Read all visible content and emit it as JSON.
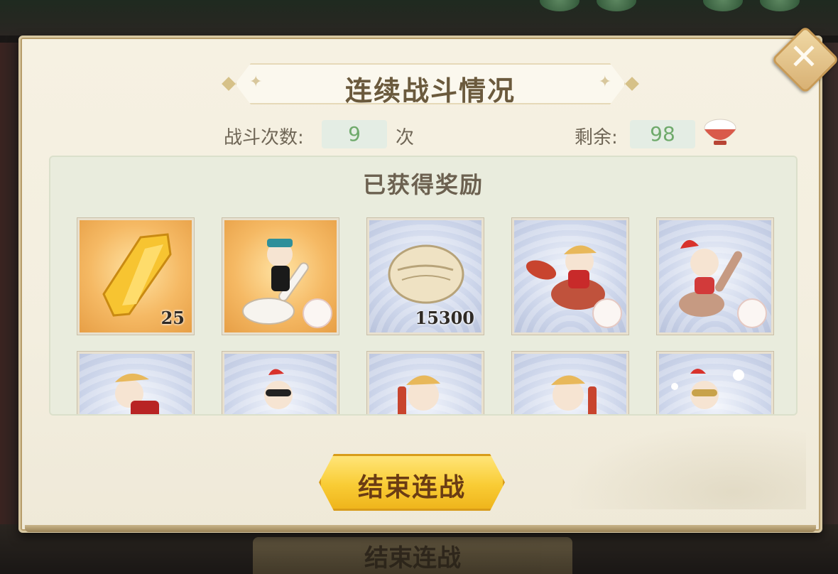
{
  "dialog": {
    "title": "连续战斗情况",
    "close_label": "✕"
  },
  "stats": {
    "battle_count_label": "战斗次数:",
    "battle_count_value": "9",
    "battle_count_unit": "次",
    "remaining_label": "剩余:",
    "remaining_value": "98",
    "remaining_icon": "rice-bowl-icon"
  },
  "rewards": {
    "title": "已获得奖励",
    "items": [
      {
        "icon": "gold-crystal-icon",
        "rarity": "gold",
        "qty": "25"
      },
      {
        "icon": "spoon-spirit-icon",
        "rarity": "gold",
        "qty": ""
      },
      {
        "icon": "shell-icon",
        "rarity": "silver",
        "qty": "15300"
      },
      {
        "icon": "spoon-spirit-icon",
        "rarity": "silver",
        "qty": ""
      },
      {
        "icon": "spoon-spirit-icon",
        "rarity": "silver",
        "qty": ""
      },
      {
        "icon": "spirit-icon",
        "rarity": "silver",
        "qty": ""
      },
      {
        "icon": "spirit-icon",
        "rarity": "silver",
        "qty": ""
      },
      {
        "icon": "spirit-icon",
        "rarity": "silver",
        "qty": ""
      },
      {
        "icon": "spirit-icon",
        "rarity": "silver",
        "qty": ""
      },
      {
        "icon": "spirit-icon",
        "rarity": "silver",
        "qty": ""
      }
    ]
  },
  "actions": {
    "end_battle_label": "结束连战"
  },
  "background": {
    "bottom_button_label": "结束连战"
  },
  "colors": {
    "count_text": "#6faa6b",
    "gold_button": "#f9cc35",
    "title_text": "#6b5a3d"
  }
}
